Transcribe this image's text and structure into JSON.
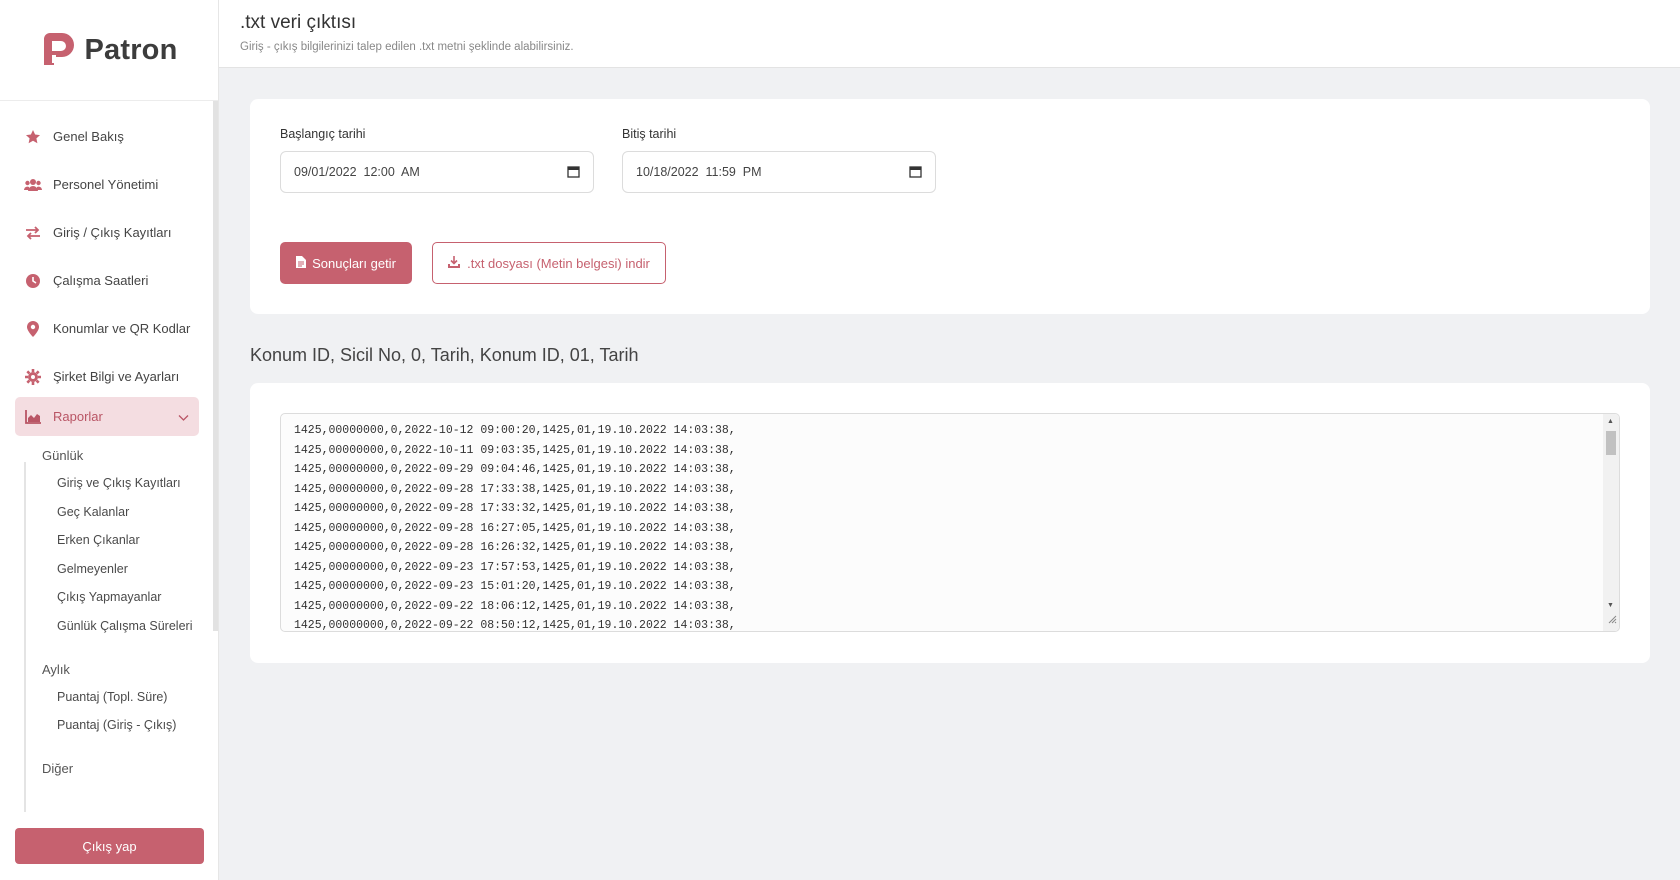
{
  "app": {
    "name": "Patron",
    "brand_color": "#c6616f"
  },
  "header": {
    "title": ".txt veri çıktısı",
    "subtitle": "Giriş - çıkış bilgilerinizi talep edilen .txt metni şeklinde alabilirsiniz."
  },
  "sidebar": {
    "items": [
      {
        "label": "Genel Bakış",
        "icon": "star-icon"
      },
      {
        "label": "Personel Yönetimi",
        "icon": "users-icon"
      },
      {
        "label": "Giriş / Çıkış Kayıtları",
        "icon": "arrows-exchange-icon"
      },
      {
        "label": "Çalışma Saatleri",
        "icon": "clock-icon"
      },
      {
        "label": "Konumlar ve QR Kodlar",
        "icon": "map-pin-icon"
      },
      {
        "label": "Şirket Bilgi ve Ayarları",
        "icon": "gear-icon"
      },
      {
        "label": "Raporlar",
        "icon": "chart-area-icon",
        "active": true
      }
    ],
    "reports": {
      "daily_title": "Günlük",
      "daily": [
        "Giriş ve Çıkış Kayıtları",
        "Geç Kalanlar",
        "Erken Çıkanlar",
        "Gelmeyenler",
        "Çıkış Yapmayanlar",
        "Günlük Çalışma Süreleri"
      ],
      "monthly_title": "Aylık",
      "monthly": [
        "Puantaj (Topl. Süre)",
        "Puantaj (Giriş - Çıkış)"
      ],
      "other_title": "Diğer"
    },
    "logout_label": "Çıkış yap"
  },
  "filters": {
    "start_label": "Başlangıç tarihi",
    "start_value": "09/01/2022  12:00  AM",
    "end_label": "Bitiş tarihi",
    "end_value": "10/18/2022  11:59  PM",
    "fetch_label": "Sonuçları getir",
    "download_label": ".txt dosyası (Metin belgesi) indir"
  },
  "output": {
    "title": "Konum ID, Sicil No, 0, Tarih, Konum ID, 01, Tarih",
    "lines": [
      "1425,00000000,0,2022-10-12 09:00:20,1425,01,19.10.2022 14:03:38,",
      "1425,00000000,0,2022-10-11 09:03:35,1425,01,19.10.2022 14:03:38,",
      "1425,00000000,0,2022-09-29 09:04:46,1425,01,19.10.2022 14:03:38,",
      "1425,00000000,0,2022-09-28 17:33:38,1425,01,19.10.2022 14:03:38,",
      "1425,00000000,0,2022-09-28 17:33:32,1425,01,19.10.2022 14:03:38,",
      "1425,00000000,0,2022-09-28 16:27:05,1425,01,19.10.2022 14:03:38,",
      "1425,00000000,0,2022-09-28 16:26:32,1425,01,19.10.2022 14:03:38,",
      "1425,00000000,0,2022-09-23 17:57:53,1425,01,19.10.2022 14:03:38,",
      "1425,00000000,0,2022-09-23 15:01:20,1425,01,19.10.2022 14:03:38,",
      "1425,00000000,0,2022-09-22 18:06:12,1425,01,19.10.2022 14:03:38,",
      "1425,00000000,0,2022-09-22 08:50:12,1425,01,19.10.2022 14:03:38,"
    ]
  }
}
